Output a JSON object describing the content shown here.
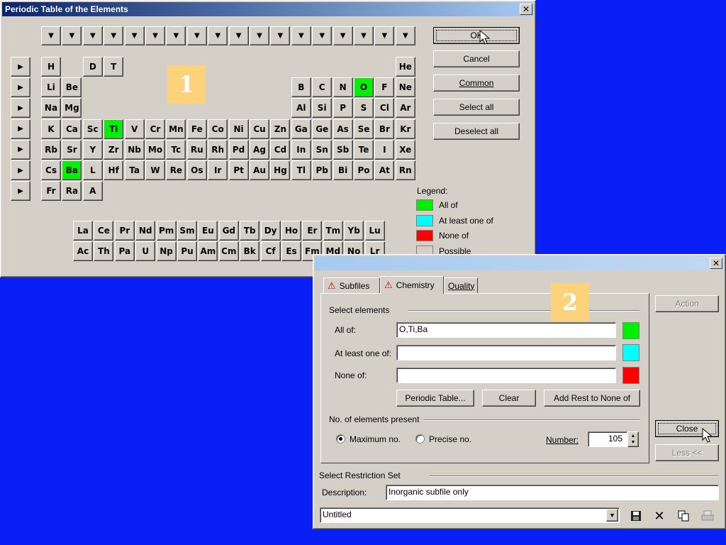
{
  "periodic": {
    "title": "Periodic Table of the Elements",
    "close_glyph": "✕",
    "column_arrow": "▼",
    "row_arrow": "▶",
    "callout": "1",
    "buttons": {
      "ok": "OK",
      "cancel": "Cancel",
      "common": "Common",
      "select_all": "Select all",
      "deselect_all": "Deselect all"
    },
    "rows": [
      [
        [
          "H",
          1,
          false
        ],
        [
          "D",
          3,
          false
        ],
        [
          "T",
          4,
          false
        ],
        [
          "He",
          18,
          false
        ]
      ],
      [
        [
          "Li",
          1,
          false
        ],
        [
          "Be",
          2,
          false
        ],
        [
          "B",
          13,
          false
        ],
        [
          "C",
          14,
          false
        ],
        [
          "N",
          15,
          false
        ],
        [
          "O",
          16,
          true
        ],
        [
          "F",
          17,
          false
        ],
        [
          "Ne",
          18,
          false
        ]
      ],
      [
        [
          "Na",
          1,
          false
        ],
        [
          "Mg",
          2,
          false
        ],
        [
          "Al",
          13,
          false
        ],
        [
          "Si",
          14,
          false
        ],
        [
          "P",
          15,
          false
        ],
        [
          "S",
          16,
          false
        ],
        [
          "Cl",
          17,
          false
        ],
        [
          "Ar",
          18,
          false
        ]
      ],
      [
        [
          "K",
          1,
          false
        ],
        [
          "Ca",
          2,
          false
        ],
        [
          "Sc",
          3,
          false
        ],
        [
          "Ti",
          4,
          true
        ],
        [
          "V",
          5,
          false
        ],
        [
          "Cr",
          6,
          false
        ],
        [
          "Mn",
          7,
          false
        ],
        [
          "Fe",
          8,
          false
        ],
        [
          "Co",
          9,
          false
        ],
        [
          "Ni",
          10,
          false
        ],
        [
          "Cu",
          11,
          false
        ],
        [
          "Zn",
          12,
          false
        ],
        [
          "Ga",
          13,
          false
        ],
        [
          "Ge",
          14,
          false
        ],
        [
          "As",
          15,
          false
        ],
        [
          "Se",
          16,
          false
        ],
        [
          "Br",
          17,
          false
        ],
        [
          "Kr",
          18,
          false
        ]
      ],
      [
        [
          "Rb",
          1,
          false
        ],
        [
          "Sr",
          2,
          false
        ],
        [
          "Y",
          3,
          false
        ],
        [
          "Zr",
          4,
          false
        ],
        [
          "Nb",
          5,
          false
        ],
        [
          "Mo",
          6,
          false
        ],
        [
          "Tc",
          7,
          false
        ],
        [
          "Ru",
          8,
          false
        ],
        [
          "Rh",
          9,
          false
        ],
        [
          "Pd",
          10,
          false
        ],
        [
          "Ag",
          11,
          false
        ],
        [
          "Cd",
          12,
          false
        ],
        [
          "In",
          13,
          false
        ],
        [
          "Sn",
          14,
          false
        ],
        [
          "Sb",
          15,
          false
        ],
        [
          "Te",
          16,
          false
        ],
        [
          "I",
          17,
          false
        ],
        [
          "Xe",
          18,
          false
        ]
      ],
      [
        [
          "Cs",
          1,
          false
        ],
        [
          "Ba",
          2,
          true
        ],
        [
          "L",
          3,
          false
        ],
        [
          "Hf",
          4,
          false
        ],
        [
          "Ta",
          5,
          false
        ],
        [
          "W",
          6,
          false
        ],
        [
          "Re",
          7,
          false
        ],
        [
          "Os",
          8,
          false
        ],
        [
          "Ir",
          9,
          false
        ],
        [
          "Pt",
          10,
          false
        ],
        [
          "Au",
          11,
          false
        ],
        [
          "Hg",
          12,
          false
        ],
        [
          "Tl",
          13,
          false
        ],
        [
          "Pb",
          14,
          false
        ],
        [
          "Bi",
          15,
          false
        ],
        [
          "Po",
          16,
          false
        ],
        [
          "At",
          17,
          false
        ],
        [
          "Rn",
          18,
          false
        ]
      ],
      [
        [
          "Fr",
          1,
          false
        ],
        [
          "Ra",
          2,
          false
        ],
        [
          "A",
          3,
          false
        ]
      ]
    ],
    "lanthanides": [
      "La",
      "Ce",
      "Pr",
      "Nd",
      "Pm",
      "Sm",
      "Eu",
      "Gd",
      "Tb",
      "Dy",
      "Ho",
      "Er",
      "Tm",
      "Yb",
      "Lu"
    ],
    "actinides": [
      "Ac",
      "Th",
      "Pa",
      "U",
      "Np",
      "Pu",
      "Am",
      "Cm",
      "Bk",
      "Cf",
      "Es",
      "Fm",
      "Md",
      "No",
      "Lr"
    ],
    "legend": {
      "title": "Legend:",
      "items": [
        {
          "label": "All of",
          "color": "#00f000"
        },
        {
          "label": "At least one of",
          "color": "#00ffff"
        },
        {
          "label": "None of",
          "color": "#ff0000"
        },
        {
          "label": "Possible",
          "color": "#d4d0c8"
        }
      ]
    }
  },
  "restriction": {
    "close_glyph": "✕",
    "callout": "2",
    "tabs": [
      "Subfiles",
      "Chemistry",
      "Quality"
    ],
    "select_elements": "Select elements",
    "all_of_label": "All of:",
    "all_of_value": "O,Ti,Ba",
    "at_least_label": "At least one of:",
    "at_least_value": "",
    "none_of_label": "None of:",
    "none_of_value": "",
    "colors": {
      "all_of": "#00f000",
      "at_least": "#00ffff",
      "none_of": "#ff0000"
    },
    "periodic_table_button": "Periodic Table...",
    "clear_button": "Clear",
    "add_rest_button": "Add Rest to None of",
    "num_elements_group": "No. of elements present",
    "max_no": "Maximum no.",
    "precise_no": "Precise no.",
    "number_label": "Number:",
    "number_value": "105",
    "action_button": "Action",
    "close_button": "Close",
    "less_button": "Less <<",
    "restriction_set": "Select Restriction Set",
    "description_label": "Description:",
    "description_value": "Inorganic subfile only",
    "set_name": "Untitled"
  }
}
